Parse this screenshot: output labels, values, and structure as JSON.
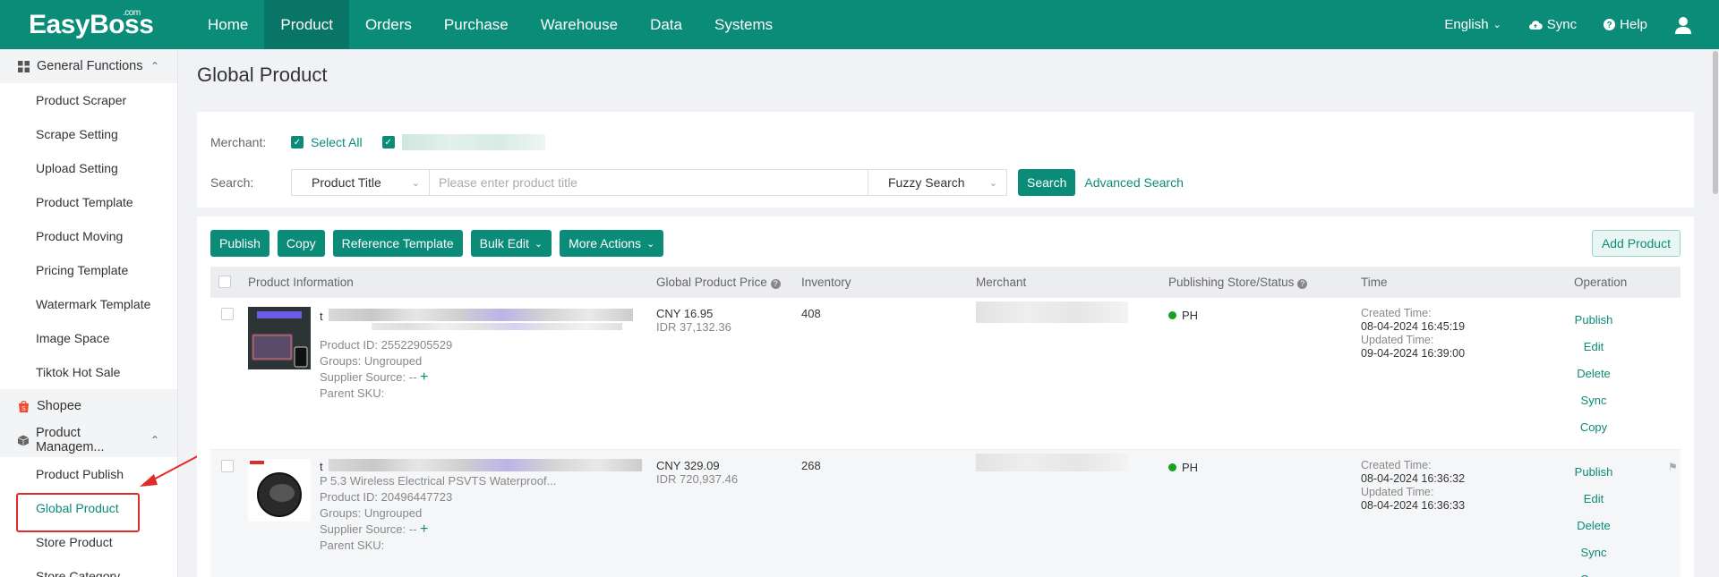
{
  "app": {
    "logo": "EasyBoss",
    "logo_sup": ".com"
  },
  "nav": {
    "items": [
      "Home",
      "Product",
      "Orders",
      "Purchase",
      "Warehouse",
      "Data",
      "Systems"
    ],
    "active": "Product"
  },
  "topright": {
    "language": "English",
    "sync": "Sync",
    "help": "Help"
  },
  "sidebar": {
    "general_functions": "General Functions",
    "general_items": [
      "Product Scraper",
      "Scrape Setting",
      "Upload Setting",
      "Product Template",
      "Product Moving",
      "Pricing Template",
      "Watermark Template",
      "Image Space",
      "Tiktok Hot Sale"
    ],
    "shopee": "Shopee",
    "product_management": "Product Managem...",
    "pm_items": [
      "Product Publish",
      "Global Product",
      "Store Product",
      "Store Category"
    ],
    "active_item": "Global Product"
  },
  "page": {
    "title": "Global Product"
  },
  "filter": {
    "merchant_label": "Merchant:",
    "select_all": "Select All",
    "search_label": "Search:",
    "field_select": "Product Title",
    "search_placeholder": "Please enter product title",
    "mode_select": "Fuzzy Search",
    "search_button": "Search",
    "advanced_search": "Advanced Search"
  },
  "toolbar": {
    "publish": "Publish",
    "copy": "Copy",
    "reference_template": "Reference Template",
    "bulk_edit": "Bulk Edit",
    "more_actions": "More Actions",
    "add_product": "Add Product"
  },
  "table": {
    "headers": {
      "product_info": "Product Information",
      "price": "Global Product Price",
      "inventory": "Inventory",
      "merchant": "Merchant",
      "publishing": "Publishing Store/Status",
      "time": "Time",
      "operation": "Operation"
    },
    "labels": {
      "product_id": "Product ID:",
      "groups": "Groups:",
      "supplier_source": "Supplier Source:",
      "parent_sku": "Parent SKU:",
      "created": "Created Time:",
      "updated": "Updated Time:"
    },
    "rows": [
      {
        "title_start": "t",
        "product_id": "25522905529",
        "groups": "Ungrouped",
        "supplier": "--",
        "price_cny": "CNY 16.95",
        "price_idr": "IDR 37,132.36",
        "inventory": "408",
        "store": "PH",
        "created": "08-04-2024 16:45:19",
        "updated": "09-04-2024 16:39:00",
        "ops": [
          "Publish",
          "Edit",
          "Delete",
          "Sync",
          "Copy"
        ]
      },
      {
        "title_start": "t",
        "title_line2": "P        5.3 Wireless Electrical PSVTS Waterproof...",
        "product_id": "20496447723",
        "groups": "Ungrouped",
        "supplier": "--",
        "price_cny": "CNY 329.09",
        "price_idr": "IDR 720,937.46",
        "inventory": "268",
        "store": "PH",
        "created": "08-04-2024 16:36:32",
        "updated": "08-04-2024 16:36:33",
        "ops": [
          "Publish",
          "Edit",
          "Delete",
          "Sync",
          "Copy"
        ]
      }
    ]
  },
  "colors": {
    "brand": "#0a8c78",
    "highlight": "#e02b2b",
    "status_ok": "#18a020"
  }
}
